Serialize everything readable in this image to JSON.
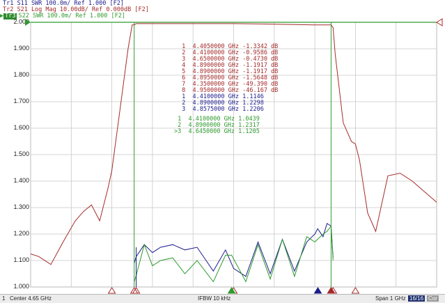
{
  "header": {
    "tr1": "Tr1 S11 SWR 100.0m/ Ref 1.000 [F2]",
    "tr2": "Tr2 S21 Log Mag 10.00dB/ Ref 0.000dB [F2]",
    "tr3_tag": "Tr3",
    "tr3": "S22 SWR 100.0m/ Ref 1.000 [F2]"
  },
  "y_axis": [
    "2.000",
    "1.900",
    "1.800",
    "1.700",
    "1.600",
    "1.500",
    "1.400",
    "1.300",
    "1.200",
    "1.100",
    "1.000"
  ],
  "colors": {
    "s21": "#a52a2a",
    "s11": "#1c1c8c",
    "s22": "#2e9a2e",
    "grid": "#c8c8c8"
  },
  "marker_tables": {
    "s21": [
      {
        "n": "1",
        "f": "4.4050000 GHz",
        "v": "-1.3342 dB"
      },
      {
        "n": "2",
        "f": "4.4100000 GHz",
        "v": "-0.9586 dB"
      },
      {
        "n": "3",
        "f": "4.6500000 GHz",
        "v": "-0.4730 dB"
      },
      {
        "n": "4",
        "f": "4.8900000 GHz",
        "v": "-1.1917 dB"
      },
      {
        "n": "5",
        "f": "4.8900000 GHz",
        "v": "-1.1917 dB"
      },
      {
        "n": "6",
        "f": "4.8950000 GHz",
        "v": "-1.5648 dB"
      },
      {
        "n": "7",
        "f": "4.3500000 GHz",
        "v": "-49.390 dB"
      },
      {
        "n": "8",
        "f": "4.9500000 GHz",
        "v": "-46.167 dB"
      }
    ],
    "s11": [
      {
        "n": "1",
        "f": "4.4100000 GHz",
        "v": "1.1146"
      },
      {
        "n": "2",
        "f": "4.8900000 GHz",
        "v": "1.2298"
      },
      {
        "n": "3",
        "f": "4.8575000 GHz",
        "v": "1.2206"
      }
    ],
    "s22": [
      {
        "n": "1",
        "f": "4.4100000 GHz",
        "v": "1.0439"
      },
      {
        "n": "2",
        "f": "4.8900000 GHz",
        "v": "1.2317"
      },
      {
        "n": ">3",
        "f": "4.6450000 GHz",
        "v": "1.1205"
      }
    ]
  },
  "status": {
    "channel": "1",
    "center": "Center 4.65 GHz",
    "ifbw": "IFBW 10 kHz",
    "span": "Span 1 GHz",
    "points": "16/16",
    "cor": "Cor"
  },
  "chart_data": {
    "type": "line",
    "x_unit": "GHz",
    "xlim": [
      4.15,
      5.15
    ],
    "ylim": [
      1.0,
      2.0
    ],
    "series": [
      {
        "name": "S21",
        "x": [
          4.15,
          4.17,
          4.2,
          4.23,
          4.26,
          4.28,
          4.3,
          4.32,
          4.34,
          4.35,
          4.37,
          4.39,
          4.4,
          4.405,
          4.41,
          4.45,
          4.55,
          4.65,
          4.75,
          4.85,
          4.88,
          4.89,
          4.895,
          4.9,
          4.92,
          4.94,
          4.95,
          4.96,
          4.98,
          5.0,
          5.03,
          5.06,
          5.09,
          5.12,
          5.15
        ],
        "y": [
          1.125,
          1.115,
          1.085,
          1.17,
          1.25,
          1.285,
          1.31,
          1.25,
          1.37,
          1.44,
          1.67,
          1.9,
          1.99,
          1.99,
          1.995,
          1.995,
          1.995,
          1.995,
          1.993,
          1.99,
          1.99,
          1.99,
          1.98,
          1.88,
          1.62,
          1.55,
          1.54,
          1.48,
          1.28,
          1.21,
          1.42,
          1.43,
          1.4,
          1.36,
          1.32
        ]
      },
      {
        "name": "S11",
        "x": [
          4.405,
          4.41,
          4.43,
          4.45,
          4.47,
          4.5,
          4.53,
          4.56,
          4.6,
          4.63,
          4.65,
          4.68,
          4.71,
          4.74,
          4.77,
          4.8,
          4.83,
          4.85,
          4.857,
          4.87,
          4.88,
          4.89,
          4.895
        ],
        "y": [
          1.09,
          1.115,
          1.16,
          1.13,
          1.15,
          1.16,
          1.14,
          1.15,
          1.06,
          1.14,
          1.07,
          1.04,
          1.17,
          1.05,
          1.18,
          1.06,
          1.17,
          1.2,
          1.22,
          1.19,
          1.24,
          1.23,
          1.11
        ]
      },
      {
        "name": "S22",
        "x": [
          4.405,
          4.41,
          4.43,
          4.45,
          4.47,
          4.5,
          4.53,
          4.56,
          4.6,
          4.63,
          4.645,
          4.68,
          4.71,
          4.74,
          4.77,
          4.8,
          4.83,
          4.85,
          4.87,
          4.88,
          4.89,
          4.895
        ],
        "y": [
          1.02,
          1.044,
          1.16,
          1.08,
          1.1,
          1.11,
          1.05,
          1.1,
          1.02,
          1.12,
          1.12,
          1.02,
          1.16,
          1.03,
          1.18,
          1.04,
          1.19,
          1.17,
          1.2,
          1.21,
          1.23,
          1.1
        ]
      }
    ],
    "markers": {
      "S21": [
        4.405,
        4.41,
        4.65,
        4.89,
        4.89,
        4.895,
        4.35,
        4.95
      ],
      "S11": [
        4.41,
        4.89,
        4.8575
      ],
      "S22": [
        4.41,
        4.89,
        4.645
      ]
    }
  }
}
